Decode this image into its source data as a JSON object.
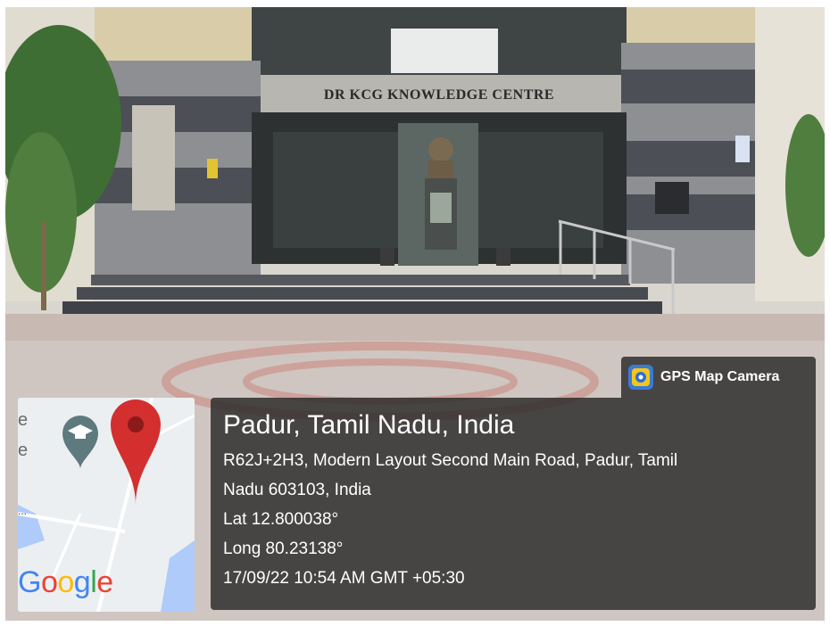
{
  "building_sign": "DR KCG KNOWLEDGE CENTRE",
  "badge": {
    "app_name": "GPS Map Camera",
    "icon": "gps-map-camera-app-icon"
  },
  "location": {
    "place": "Padur, Tamil Nadu, India",
    "address_line1": "R62J+2H3, Modern Layout Second Main Road, Padur, Tamil",
    "address_line2": "Nadu 603103, India",
    "latitude": "Lat 12.800038°",
    "longitude": "Long 80.23138°",
    "timestamp": "17/09/22 10:54 AM GMT +05:30"
  },
  "map": {
    "label_1": "e",
    "label_2": "e",
    "dots": "...",
    "logo": [
      "G",
      "o",
      "o",
      "g",
      "l",
      "e"
    ],
    "logo_colors": [
      "#4285F4",
      "#EA4335",
      "#FBBC05",
      "#4285F4",
      "#34A853",
      "#EA4335"
    ],
    "pin_color": "#D32F2F",
    "poi_icon": "graduation-cap-icon"
  }
}
